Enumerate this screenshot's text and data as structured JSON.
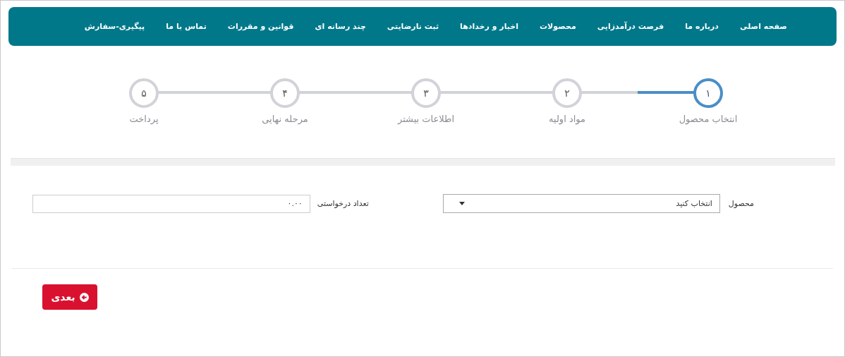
{
  "nav": {
    "items": [
      "صفحه اصلی",
      "درباره ما",
      "فرصت درآمدزایی",
      "محصولات",
      "اخبار و رخدادها",
      "ثبت نارضایتی",
      "چند رسانه ای",
      "قوانین و مقررات",
      "تماس با ما",
      "پیگیری-سفارش"
    ]
  },
  "steps": [
    {
      "number": "۱",
      "label": "انتخاب محصول",
      "selected": true
    },
    {
      "number": "۲",
      "label": "مواد اولیه",
      "selected": false
    },
    {
      "number": "۳",
      "label": "اطلاعات بیشتر",
      "selected": false
    },
    {
      "number": "۴",
      "label": "مرحله نهایی",
      "selected": false
    },
    {
      "number": "۵",
      "label": "پرداخت",
      "selected": false
    }
  ],
  "form": {
    "product": {
      "label": "محصول",
      "value": "انتخاب کنید"
    },
    "quantity": {
      "label": "تعداد درخواستی",
      "value": "۰.۰۰"
    }
  },
  "next_button": "بعدی"
}
